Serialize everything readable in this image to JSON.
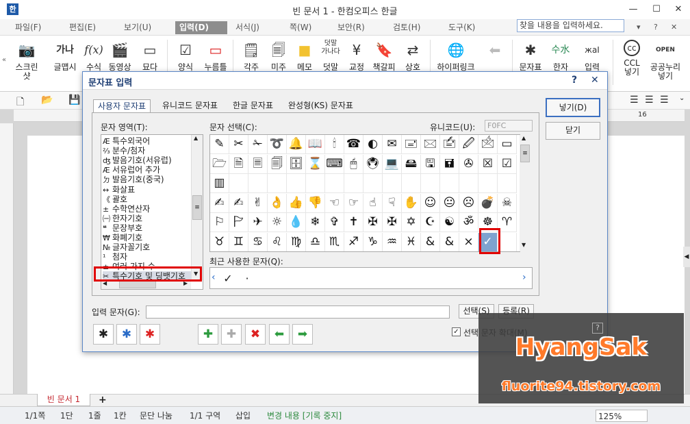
{
  "window": {
    "title": "빈 문서 1 - 한컴오피스 한글",
    "minimize": "—",
    "maximize": "☐",
    "close": "✕"
  },
  "menu": {
    "items": [
      {
        "label": "파일(F)"
      },
      {
        "label": "편집(E)"
      },
      {
        "label": "보기(U)"
      },
      {
        "label": "입력(D)",
        "active": true
      },
      {
        "label": "서식(J)"
      },
      {
        "label": "쪽(W)"
      },
      {
        "label": "보안(R)"
      },
      {
        "label": "검토(H)"
      },
      {
        "label": "도구(K)"
      }
    ],
    "search_placeholder": "찾을 내용을 입력하세요."
  },
  "ribbon": {
    "buttons": [
      {
        "label": "스크린\n샷",
        "icon": "camera-icon"
      },
      {
        "label": "글맵시",
        "icon": "text-art-icon"
      },
      {
        "label": "수식",
        "icon": "formula-icon"
      },
      {
        "label": "동영상",
        "icon": "video-icon"
      },
      {
        "label": "묘다",
        "icon": "frame-icon"
      },
      {
        "label": "양식",
        "icon": "form-icon"
      },
      {
        "label": "누름틀",
        "icon": "field-icon"
      },
      {
        "label": "각주",
        "icon": "footnote-icon"
      },
      {
        "label": "미주",
        "icon": "endnote-icon"
      },
      {
        "label": "메모",
        "icon": "memo-icon"
      },
      {
        "label": "덧말",
        "icon": "ruby-icon"
      },
      {
        "label": "교정",
        "icon": "proofread-icon"
      },
      {
        "label": "책갈피",
        "icon": "bookmark-icon"
      },
      {
        "label": "상호",
        "icon": "cross-ref-icon"
      },
      {
        "label": "하이퍼링크",
        "icon": "globe-icon"
      },
      {
        "label": "",
        "icon": "arrow-left-icon"
      },
      {
        "label": "문자표",
        "icon": "symbol-icon"
      },
      {
        "label": "한자",
        "icon": "hanja-icon"
      },
      {
        "label": "입력",
        "icon": "input-icon"
      },
      {
        "label": "CCL\n넣기",
        "icon": "ccl-icon"
      },
      {
        "label": "공공누리\n넣기",
        "icon": "open-icon"
      }
    ],
    "top_labels": {
      "text_art": "가나",
      "formula": "f(x)",
      "ruby": "덧말\n가나다",
      "hanja": "수水",
      "input": "жaI",
      "ccl": "cc",
      "open": "OPEN"
    }
  },
  "ruler": {
    "mark": "16"
  },
  "dialog": {
    "title": "문자표 입력",
    "help": "?",
    "close": "✕",
    "tabs": [
      {
        "label": "사용자 문자표",
        "active": true
      },
      {
        "label": "유니코드 문자표"
      },
      {
        "label": "한글 문자표"
      },
      {
        "label": "완성형(KS) 문자표"
      }
    ],
    "area_label": "문자 영역(T):",
    "char_select_label": "문자 선택(C):",
    "unicode_label": "유니코드(U):",
    "unicode_value": "F0FC",
    "recent_label": "최근 사용한 문자(Q):",
    "recent_chars": [
      "✓",
      "·"
    ],
    "areas": [
      {
        "glyph": "Æ",
        "label": "특수외국어"
      },
      {
        "glyph": "⅔",
        "label": "분수/첨자"
      },
      {
        "glyph": "ʤ",
        "label": "발음기호(서유럽)"
      },
      {
        "glyph": "Æ",
        "label": "서유럽어 추가"
      },
      {
        "glyph": "ㄉ",
        "label": "발음기호(중국)"
      },
      {
        "glyph": "↔",
        "label": "화살표"
      },
      {
        "glyph": "《",
        "label": "괄호"
      },
      {
        "glyph": "±",
        "label": "수학연산자"
      },
      {
        "glyph": "㈠",
        "label": "한자기호"
      },
      {
        "glyph": "❝",
        "label": "문장부호"
      },
      {
        "glyph": "₩",
        "label": "화폐기호"
      },
      {
        "glyph": "№",
        "label": "글자꼴기호"
      },
      {
        "glyph": "¹",
        "label": "첨자"
      },
      {
        "glyph": "±",
        "label": "여러 가지 수"
      },
      {
        "glyph": "✂",
        "label": "특수기호 및 딩뱃기호",
        "selected": true
      }
    ],
    "grid_rows": [
      [
        "✎",
        "✂",
        "✁",
        "➰",
        "🔔",
        "📖",
        "🕯",
        "☎",
        "◐",
        "✉",
        "🖃",
        "🖂",
        "🖆",
        "🖉",
        "🖄",
        "▭"
      ],
      [
        "🗁",
        "🗎",
        "🗏",
        "🗐",
        "🗄",
        "⌛",
        "⌨",
        "🖱",
        "🖲",
        "💻",
        "🖴",
        "🖫",
        "🖬",
        "✇",
        "☒",
        "☑"
      ],
      [
        "▥",
        "",
        "",
        "",
        "",
        "",
        "",
        "",
        "",
        "",
        "",
        "",
        "",
        "",
        "",
        ""
      ],
      [
        "✍",
        "✍",
        "✌",
        "👌",
        "👍",
        "👎",
        "☜",
        "☞",
        "☝",
        "☟",
        "✋",
        "☺",
        "😐",
        "☹",
        "💣",
        "☠"
      ],
      [
        "⚐",
        "🏱",
        "✈",
        "☼",
        "💧",
        "❄",
        "✞",
        "✝",
        "✠",
        "✠",
        "✡",
        "☪",
        "☯",
        "ॐ",
        "☸",
        "♈"
      ],
      [
        "♉",
        "♊",
        "♋",
        "♌",
        "♍",
        "♎",
        "♏",
        "♐",
        "♑",
        "♒",
        "♓",
        "&",
        "&",
        "×",
        "✓",
        ""
      ]
    ],
    "selected_char": "✓",
    "insert_button": "넣기(D)",
    "close_button": "닫기",
    "input_label": "입력 문자(G):",
    "select_button": "선택(S)",
    "register_button": "등록(R)",
    "enlarge_label": "선택 문자 확대(M)",
    "enlarge_checked": true,
    "tool_icons": [
      "✱",
      "✱",
      "✱",
      "✚",
      "✚",
      "✖",
      "⬅",
      "➡"
    ]
  },
  "tabbar": {
    "doc_tab": "빈 문서 1",
    "add_tab": "+"
  },
  "status": {
    "items": [
      "1/1쪽",
      "1단",
      "1줄",
      "1칸",
      "문단 나눔",
      "1/1 구역",
      "삽입",
      "변경 내용 [기록 중지]"
    ],
    "zoom": "125%"
  },
  "watermark": {
    "title": "HyangSak",
    "url": "fluorite94.tistory.com"
  },
  "colors": {
    "accent": "#1f3f74",
    "red": "#e00000",
    "orange": "#ff7a2a",
    "selected": "#7fa3cf"
  }
}
